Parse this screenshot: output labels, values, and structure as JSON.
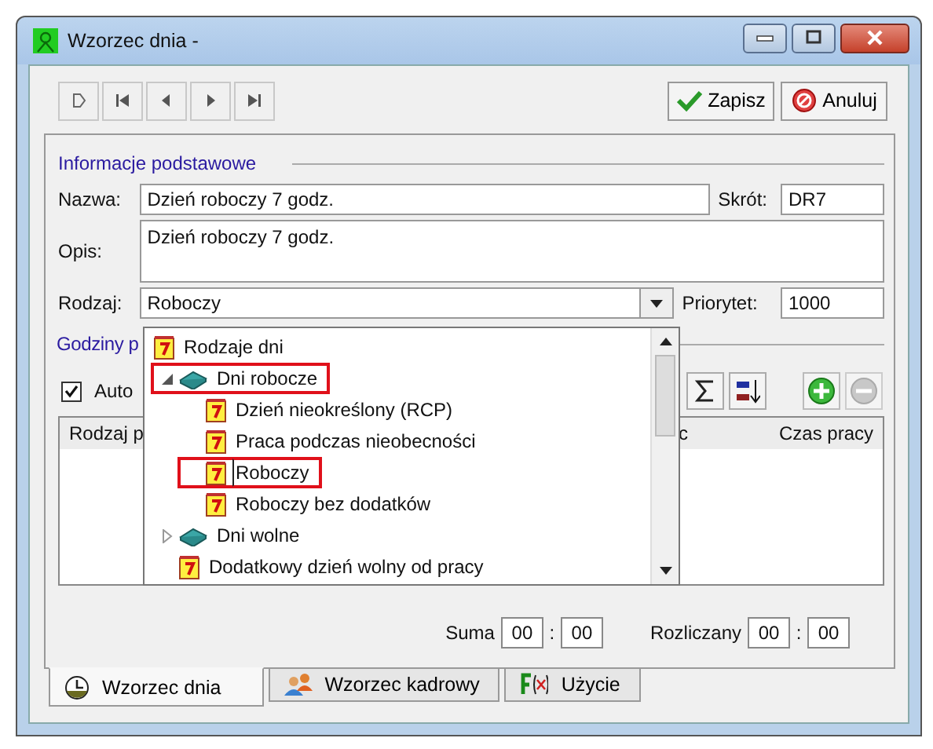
{
  "window": {
    "title": "Wzorzec dnia -"
  },
  "actions": [
    {
      "label": "Zapisz",
      "kind": "save"
    },
    {
      "label": "Anuluj",
      "kind": "cancel"
    }
  ],
  "basic_section": {
    "title": "Informacje podstawowe"
  },
  "fields": {
    "name_label": "Nazwa:",
    "name": "Dzień roboczy 7 godz.",
    "short_label": "Skrót:",
    "short": "DR7",
    "desc_label": "Opis:",
    "desc": "Dzień roboczy 7 godz.",
    "type_label": "Rodzaj:",
    "type": "Roboczy",
    "priority_label": "Priorytet:",
    "priority": "1000"
  },
  "hours_section": {
    "title": "Godziny p"
  },
  "auto_checkbox": {
    "label": "Auto",
    "checked": true
  },
  "table": {
    "columns": [
      "Rodzaj p",
      "c",
      "Czas pracy"
    ]
  },
  "totals": {
    "sum_label": "Suma",
    "sum_h": "00",
    "sum_m": "00",
    "settled_label": "Rozliczany",
    "settled_h": "00",
    "settled_m": "00",
    "separator": ":"
  },
  "dropdown_tree": [
    {
      "label": "Rodzaje dni",
      "kind": "root",
      "selected": false,
      "highlighted": false
    },
    {
      "label": "Dni robocze",
      "kind": "group",
      "expanded": true,
      "selected": false,
      "highlighted": true,
      "children": [
        {
          "label": "Dzień nieokreślony (RCP)",
          "kind": "type",
          "selected": false,
          "highlighted": false
        },
        {
          "label": "Praca podczas nieobecności",
          "kind": "type",
          "selected": false,
          "highlighted": false
        },
        {
          "label": "Roboczy",
          "kind": "type",
          "selected": true,
          "highlighted": true
        },
        {
          "label": "Roboczy bez dodatków",
          "kind": "type",
          "selected": false,
          "highlighted": false
        }
      ]
    },
    {
      "label": "Dni wolne",
      "kind": "group",
      "expanded": false,
      "selected": false,
      "highlighted": false
    },
    {
      "label": "Dodatkowy dzień wolny od pracy",
      "kind": "type",
      "selected": false,
      "highlighted": false
    }
  ],
  "tabs": [
    {
      "label": "Wzorzec dnia",
      "kind": "clock",
      "selected": true
    },
    {
      "label": "Wzorzec kadrowy",
      "kind": "people",
      "selected": false
    },
    {
      "label": "Użycie",
      "kind": "formula",
      "selected": false
    }
  ]
}
